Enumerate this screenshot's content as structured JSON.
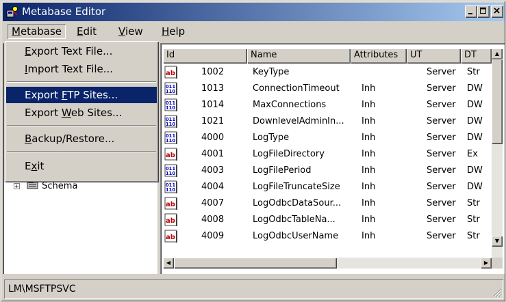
{
  "window": {
    "title": "Metabase Editor"
  },
  "menubar": {
    "metabase": "Metabase",
    "edit": "Edit",
    "view": "View",
    "help": "Help"
  },
  "dropdown": {
    "export_text": "Export Text File...",
    "import_text": "Import Text File...",
    "export_ftp": "Export FTP Sites...",
    "export_web": "Export Web Sites...",
    "backup": "Backup/Restore...",
    "exit": "Exit"
  },
  "tree": {
    "schema": "Schema"
  },
  "list": {
    "columns": [
      "Id",
      "Name",
      "Attributes",
      "UT",
      "DT"
    ],
    "rows": [
      {
        "icon": "string-icon",
        "id": "1002",
        "name": "KeyType",
        "attr": "",
        "ut": "Server",
        "dt": "Str"
      },
      {
        "icon": "binary-icon",
        "id": "1013",
        "name": "ConnectionTimeout",
        "attr": "Inh",
        "ut": "Server",
        "dt": "DW"
      },
      {
        "icon": "binary-icon",
        "id": "1014",
        "name": "MaxConnections",
        "attr": "Inh",
        "ut": "Server",
        "dt": "DW"
      },
      {
        "icon": "binary-icon",
        "id": "1021",
        "name": "DownlevelAdminIn...",
        "attr": "Inh",
        "ut": "Server",
        "dt": "DW"
      },
      {
        "icon": "binary-icon",
        "id": "4000",
        "name": "LogType",
        "attr": "Inh",
        "ut": "Server",
        "dt": "DW"
      },
      {
        "icon": "string-icon",
        "id": "4001",
        "name": "LogFileDirectory",
        "attr": "Inh",
        "ut": "Server",
        "dt": "Ex"
      },
      {
        "icon": "binary-icon",
        "id": "4003",
        "name": "LogFilePeriod",
        "attr": "Inh",
        "ut": "Server",
        "dt": "DW"
      },
      {
        "icon": "binary-icon",
        "id": "4004",
        "name": "LogFileTruncateSize",
        "attr": "Inh",
        "ut": "Server",
        "dt": "DW"
      },
      {
        "icon": "string-icon",
        "id": "4007",
        "name": "LogOdbcDataSour...",
        "attr": "Inh",
        "ut": "Server",
        "dt": "Str"
      },
      {
        "icon": "string-icon",
        "id": "4008",
        "name": "LogOdbcTableNa...",
        "attr": "Inh",
        "ut": "Server",
        "dt": "Str"
      },
      {
        "icon": "string-icon",
        "id": "4009",
        "name": "LogOdbcUserName",
        "attr": "Inh",
        "ut": "Server",
        "dt": "Str"
      }
    ]
  },
  "status": {
    "path": "LM\\MSFTPSVC"
  },
  "colors": {
    "titlebar": "#0a246a",
    "highlight": "#0a246a",
    "face": "#d4d0c8"
  }
}
